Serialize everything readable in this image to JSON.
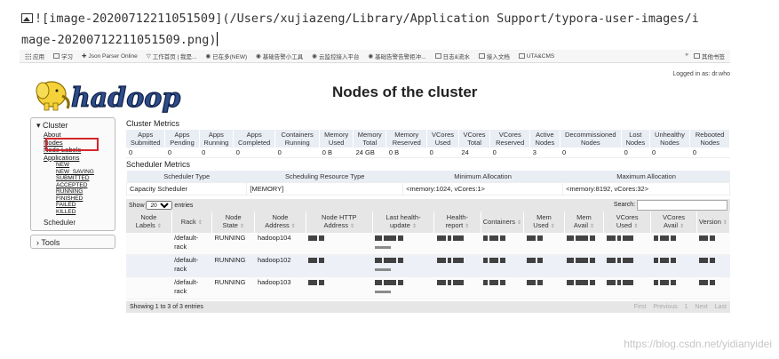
{
  "markdown": {
    "line1": "![image-20200712211051509](/Users/xujiazeng/Library/Application Support/typora-user-images/i",
    "line2": "mage-20200712211051509.png)"
  },
  "bookmarks": {
    "items": [
      "应用",
      "学习",
      "Json Parser Online",
      "工作首页 | 我是...",
      "已在多(NEW)",
      "基础告警小工具",
      "云监控接入平台",
      "基础告警告警拒冲...",
      "日志&流水",
      "接入文档",
      "UTA&CMS"
    ],
    "right_items": [
      "»",
      "其他书签"
    ]
  },
  "header": {
    "logo_text": "hadoop",
    "title": "Nodes of the cluster",
    "logged_in": "Logged in as: dr.who"
  },
  "sidebar": {
    "cluster_label": "Cluster",
    "about": "About",
    "nodes": "Nodes",
    "node_labels": "Node Labels",
    "applications": "Applications",
    "app_states": [
      "NEW",
      "NEW_SAVING",
      "SUBMITTED",
      "ACCEPTED",
      "RUNNING",
      "FINISHED",
      "FAILED",
      "KILLED"
    ],
    "scheduler": "Scheduler",
    "tools_label": "Tools"
  },
  "metrics": {
    "title": "Cluster Metrics",
    "headers": [
      "Apps Submitted",
      "Apps Pending",
      "Apps Running",
      "Apps Completed",
      "Containers Running",
      "Memory Used",
      "Memory Total",
      "Memory Reserved",
      "VCores Used",
      "VCores Total",
      "VCores Reserved",
      "Active Nodes",
      "Decommissioned Nodes",
      "Lost Nodes",
      "Unhealthy Nodes",
      "Rebooted Nodes"
    ],
    "values": [
      "0",
      "0",
      "0",
      "0",
      "0",
      "0 B",
      "24 GB",
      "0 B",
      "0",
      "24",
      "0",
      "3",
      "0",
      "0",
      "0",
      "0"
    ]
  },
  "scheduler_metrics": {
    "title": "Scheduler Metrics",
    "headers": [
      "Scheduler Type",
      "Scheduling Resource Type",
      "Minimum Allocation",
      "Maximum Allocation"
    ],
    "values": [
      "Capacity Scheduler",
      "[MEMORY]",
      "<memory:1024, vCores:1>",
      "<memory:8192, vCores:32>"
    ]
  },
  "controls": {
    "show_label": "Show",
    "entries_value": "20",
    "entries_label": "entries",
    "search_label": "Search:"
  },
  "nodes_table": {
    "headers": [
      "Node Labels",
      "Rack",
      "Node State",
      "Node Address",
      "Node HTTP Address",
      "Last health-update",
      "Health-report",
      "Containers",
      "Mem Used",
      "Mem Avail",
      "VCores Used",
      "VCores Avail",
      "Version"
    ],
    "rows": [
      {
        "rack": "/default-rack",
        "state": "RUNNING",
        "address": "hadoop104"
      },
      {
        "rack": "/default-rack",
        "state": "RUNNING",
        "address": "hadoop102"
      },
      {
        "rack": "/default-rack",
        "state": "RUNNING",
        "address": "hadoop103"
      }
    ]
  },
  "footer": {
    "info": "Showing 1 to 3 of 3 entries",
    "first": "First",
    "previous": "Previous",
    "page": "1",
    "next": "Next",
    "last": "Last"
  },
  "watermark": "https://blog.csdn.net/yidianyidei"
}
